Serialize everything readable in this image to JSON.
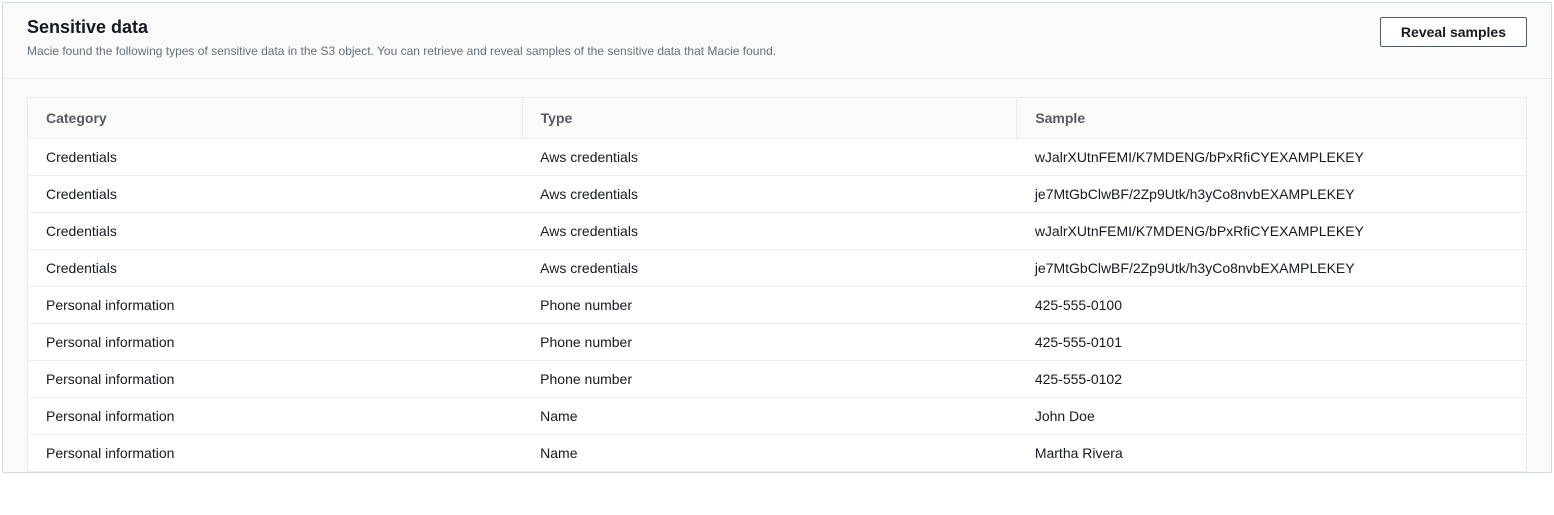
{
  "panel": {
    "title": "Sensitive data",
    "description": "Macie found the following types of sensitive data in the S3 object. You can retrieve and reveal samples of the sensitive data that Macie found.",
    "reveal_button": "Reveal samples"
  },
  "table": {
    "headers": {
      "category": "Category",
      "type": "Type",
      "sample": "Sample"
    },
    "rows": [
      {
        "category": "Credentials",
        "type": "Aws credentials",
        "sample": "wJalrXUtnFEMI/K7MDENG/bPxRfiCYEXAMPLEKEY"
      },
      {
        "category": "Credentials",
        "type": "Aws credentials",
        "sample": "je7MtGbClwBF/2Zp9Utk/h3yCo8nvbEXAMPLEKEY"
      },
      {
        "category": "Credentials",
        "type": "Aws credentials",
        "sample": "wJalrXUtnFEMI/K7MDENG/bPxRfiCYEXAMPLEKEY"
      },
      {
        "category": "Credentials",
        "type": "Aws credentials",
        "sample": "je7MtGbClwBF/2Zp9Utk/h3yCo8nvbEXAMPLEKEY"
      },
      {
        "category": "Personal information",
        "type": "Phone number",
        "sample": "425-555-0100"
      },
      {
        "category": "Personal information",
        "type": "Phone number",
        "sample": "425-555-0101"
      },
      {
        "category": "Personal information",
        "type": "Phone number",
        "sample": "425-555-0102"
      },
      {
        "category": "Personal information",
        "type": "Name",
        "sample": "John Doe"
      },
      {
        "category": "Personal information",
        "type": "Name",
        "sample": "Martha Rivera"
      }
    ]
  }
}
